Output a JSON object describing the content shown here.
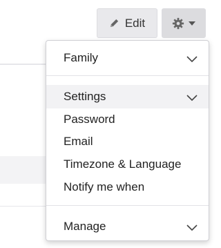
{
  "toolbar": {
    "edit_label": "Edit",
    "edit_icon": "pencil-icon",
    "settings_icon": "gear-icon",
    "settings_caret_icon": "caret-down-icon"
  },
  "menu": {
    "family": {
      "label": "Family",
      "icon": "chevron-down-icon"
    },
    "settings": {
      "label": "Settings",
      "icon": "chevron-down-icon"
    },
    "items": [
      "Password",
      "Email",
      "Timezone & Language",
      "Notify me when"
    ],
    "manage": {
      "label": "Manage",
      "icon": "chevron-down-icon"
    }
  }
}
